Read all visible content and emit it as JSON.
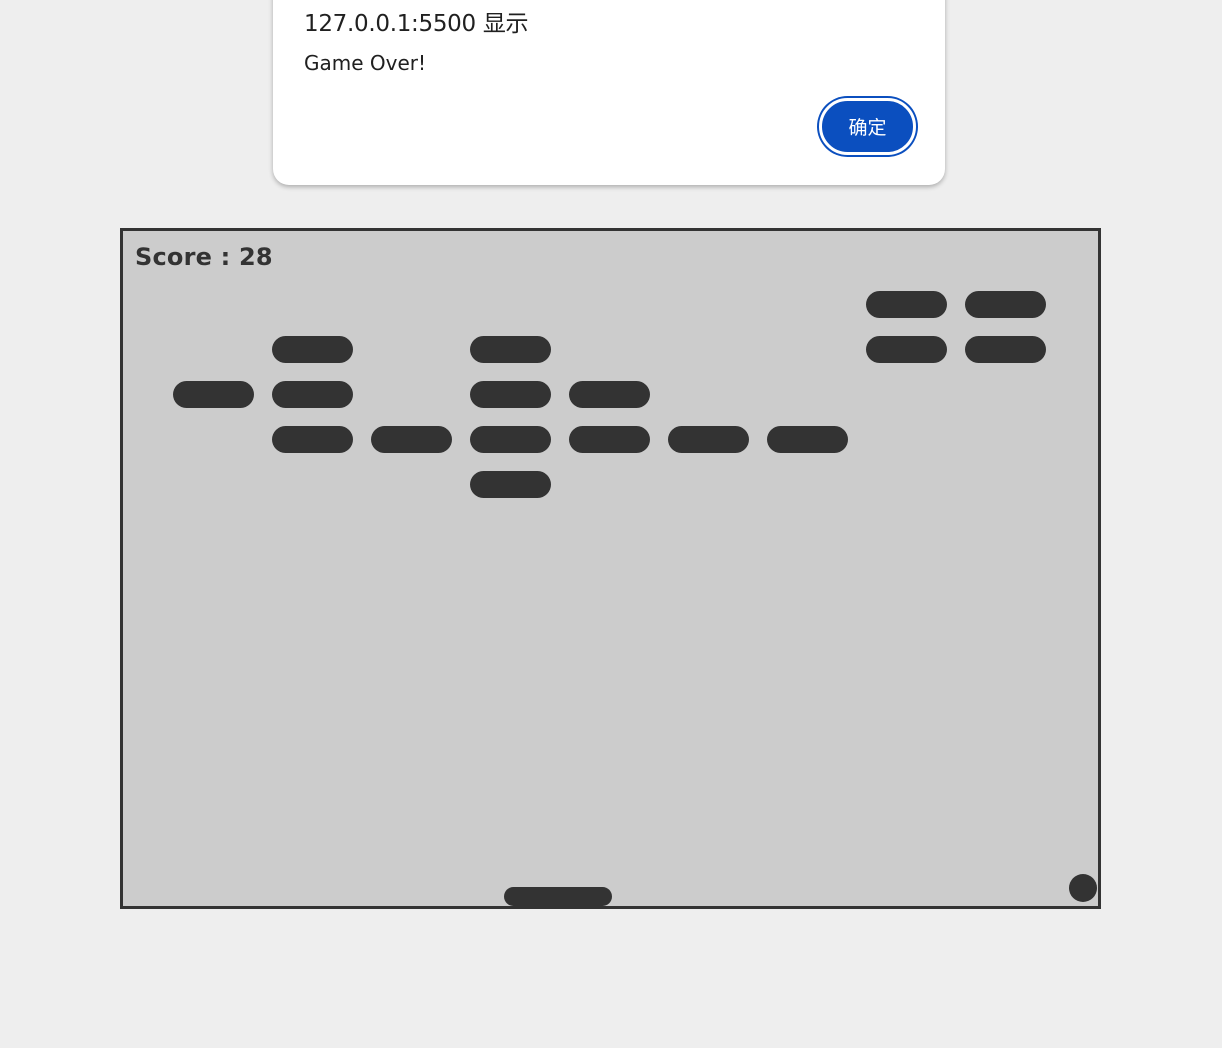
{
  "dialog": {
    "title": "127.0.0.1:5500 显示",
    "message": "Game Over!",
    "ok_label": "确定"
  },
  "game": {
    "score_text": "Score : 28",
    "score": 28,
    "colors": {
      "background": "#cccccc",
      "foreground": "#333333",
      "page": "#eeeeee",
      "button": "#0b4fbf"
    }
  }
}
